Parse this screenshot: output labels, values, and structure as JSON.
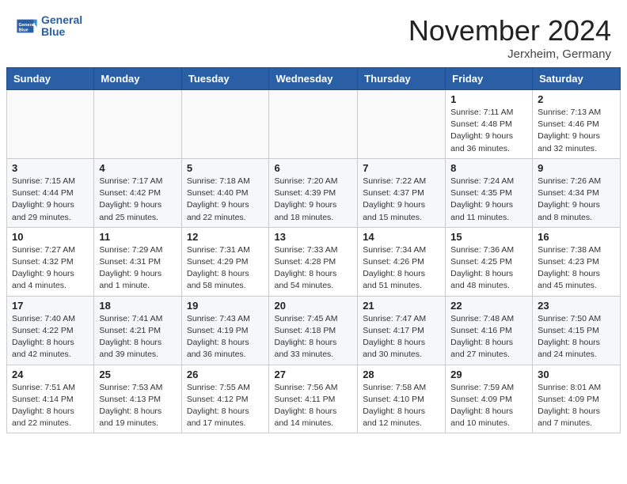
{
  "header": {
    "logo_line1": "General",
    "logo_line2": "Blue",
    "month_title": "November 2024",
    "location": "Jerxheim, Germany"
  },
  "weekdays": [
    "Sunday",
    "Monday",
    "Tuesday",
    "Wednesday",
    "Thursday",
    "Friday",
    "Saturday"
  ],
  "weeks": [
    [
      {
        "day": "",
        "info": ""
      },
      {
        "day": "",
        "info": ""
      },
      {
        "day": "",
        "info": ""
      },
      {
        "day": "",
        "info": ""
      },
      {
        "day": "",
        "info": ""
      },
      {
        "day": "1",
        "info": "Sunrise: 7:11 AM\nSunset: 4:48 PM\nDaylight: 9 hours and 36 minutes."
      },
      {
        "day": "2",
        "info": "Sunrise: 7:13 AM\nSunset: 4:46 PM\nDaylight: 9 hours and 32 minutes."
      }
    ],
    [
      {
        "day": "3",
        "info": "Sunrise: 7:15 AM\nSunset: 4:44 PM\nDaylight: 9 hours and 29 minutes."
      },
      {
        "day": "4",
        "info": "Sunrise: 7:17 AM\nSunset: 4:42 PM\nDaylight: 9 hours and 25 minutes."
      },
      {
        "day": "5",
        "info": "Sunrise: 7:18 AM\nSunset: 4:40 PM\nDaylight: 9 hours and 22 minutes."
      },
      {
        "day": "6",
        "info": "Sunrise: 7:20 AM\nSunset: 4:39 PM\nDaylight: 9 hours and 18 minutes."
      },
      {
        "day": "7",
        "info": "Sunrise: 7:22 AM\nSunset: 4:37 PM\nDaylight: 9 hours and 15 minutes."
      },
      {
        "day": "8",
        "info": "Sunrise: 7:24 AM\nSunset: 4:35 PM\nDaylight: 9 hours and 11 minutes."
      },
      {
        "day": "9",
        "info": "Sunrise: 7:26 AM\nSunset: 4:34 PM\nDaylight: 9 hours and 8 minutes."
      }
    ],
    [
      {
        "day": "10",
        "info": "Sunrise: 7:27 AM\nSunset: 4:32 PM\nDaylight: 9 hours and 4 minutes."
      },
      {
        "day": "11",
        "info": "Sunrise: 7:29 AM\nSunset: 4:31 PM\nDaylight: 9 hours and 1 minute."
      },
      {
        "day": "12",
        "info": "Sunrise: 7:31 AM\nSunset: 4:29 PM\nDaylight: 8 hours and 58 minutes."
      },
      {
        "day": "13",
        "info": "Sunrise: 7:33 AM\nSunset: 4:28 PM\nDaylight: 8 hours and 54 minutes."
      },
      {
        "day": "14",
        "info": "Sunrise: 7:34 AM\nSunset: 4:26 PM\nDaylight: 8 hours and 51 minutes."
      },
      {
        "day": "15",
        "info": "Sunrise: 7:36 AM\nSunset: 4:25 PM\nDaylight: 8 hours and 48 minutes."
      },
      {
        "day": "16",
        "info": "Sunrise: 7:38 AM\nSunset: 4:23 PM\nDaylight: 8 hours and 45 minutes."
      }
    ],
    [
      {
        "day": "17",
        "info": "Sunrise: 7:40 AM\nSunset: 4:22 PM\nDaylight: 8 hours and 42 minutes."
      },
      {
        "day": "18",
        "info": "Sunrise: 7:41 AM\nSunset: 4:21 PM\nDaylight: 8 hours and 39 minutes."
      },
      {
        "day": "19",
        "info": "Sunrise: 7:43 AM\nSunset: 4:19 PM\nDaylight: 8 hours and 36 minutes."
      },
      {
        "day": "20",
        "info": "Sunrise: 7:45 AM\nSunset: 4:18 PM\nDaylight: 8 hours and 33 minutes."
      },
      {
        "day": "21",
        "info": "Sunrise: 7:47 AM\nSunset: 4:17 PM\nDaylight: 8 hours and 30 minutes."
      },
      {
        "day": "22",
        "info": "Sunrise: 7:48 AM\nSunset: 4:16 PM\nDaylight: 8 hours and 27 minutes."
      },
      {
        "day": "23",
        "info": "Sunrise: 7:50 AM\nSunset: 4:15 PM\nDaylight: 8 hours and 24 minutes."
      }
    ],
    [
      {
        "day": "24",
        "info": "Sunrise: 7:51 AM\nSunset: 4:14 PM\nDaylight: 8 hours and 22 minutes."
      },
      {
        "day": "25",
        "info": "Sunrise: 7:53 AM\nSunset: 4:13 PM\nDaylight: 8 hours and 19 minutes."
      },
      {
        "day": "26",
        "info": "Sunrise: 7:55 AM\nSunset: 4:12 PM\nDaylight: 8 hours and 17 minutes."
      },
      {
        "day": "27",
        "info": "Sunrise: 7:56 AM\nSunset: 4:11 PM\nDaylight: 8 hours and 14 minutes."
      },
      {
        "day": "28",
        "info": "Sunrise: 7:58 AM\nSunset: 4:10 PM\nDaylight: 8 hours and 12 minutes."
      },
      {
        "day": "29",
        "info": "Sunrise: 7:59 AM\nSunset: 4:09 PM\nDaylight: 8 hours and 10 minutes."
      },
      {
        "day": "30",
        "info": "Sunrise: 8:01 AM\nSunset: 4:09 PM\nDaylight: 8 hours and 7 minutes."
      }
    ]
  ]
}
